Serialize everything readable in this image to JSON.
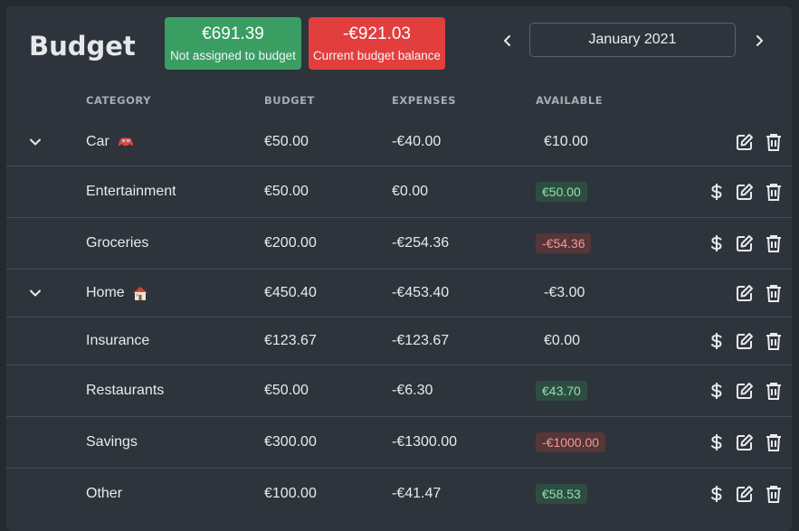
{
  "page": {
    "title": "Budget"
  },
  "stats": {
    "not_assigned": {
      "amount": "€691.39",
      "label": "Not assigned to budget",
      "color": "#3a9e63"
    },
    "balance": {
      "amount": "-€921.03",
      "label": "Current budget balance",
      "color": "#e23e3e"
    }
  },
  "month_nav": {
    "current": "January 2021",
    "prev_icon": "chevron-left-icon",
    "next_icon": "chevron-right-icon"
  },
  "table": {
    "headers": {
      "category": "CATEGORY",
      "budget": "BUDGET",
      "expenses": "EXPENSES",
      "available": "AVAILABLE"
    },
    "groups": [
      {
        "name": "Car",
        "emoji_icon": "car-icon",
        "budget": "€50.00",
        "expenses": "-€40.00",
        "available": "€10.00",
        "items": [
          {
            "name": "Entertainment",
            "budget": "€50.00",
            "expenses": "€0.00",
            "available": "€50.00",
            "status": "positive"
          },
          {
            "name": "Groceries",
            "budget": "€200.00",
            "expenses": "-€254.36",
            "available": "-€54.36",
            "status": "negative"
          }
        ]
      },
      {
        "name": "Home",
        "emoji_icon": "house-icon",
        "budget": "€450.40",
        "expenses": "-€453.40",
        "available": "-€3.00",
        "items": [
          {
            "name": "Insurance",
            "budget": "€123.67",
            "expenses": "-€123.67",
            "available": "€0.00",
            "status": "zero"
          },
          {
            "name": "Restaurants",
            "budget": "€50.00",
            "expenses": "-€6.30",
            "available": "€43.70",
            "status": "positive"
          },
          {
            "name": "Savings",
            "budget": "€300.00",
            "expenses": "-€1300.00",
            "available": "-€1000.00",
            "status": "negative"
          },
          {
            "name": "Other",
            "budget": "€100.00",
            "expenses": "-€41.47",
            "available": "€58.53",
            "status": "positive"
          }
        ]
      }
    ]
  },
  "colors": {
    "positive_text": "#8fe0b0",
    "positive_bg": "#2e4d41",
    "negative_text": "#f29a9a",
    "negative_bg": "#553639"
  }
}
